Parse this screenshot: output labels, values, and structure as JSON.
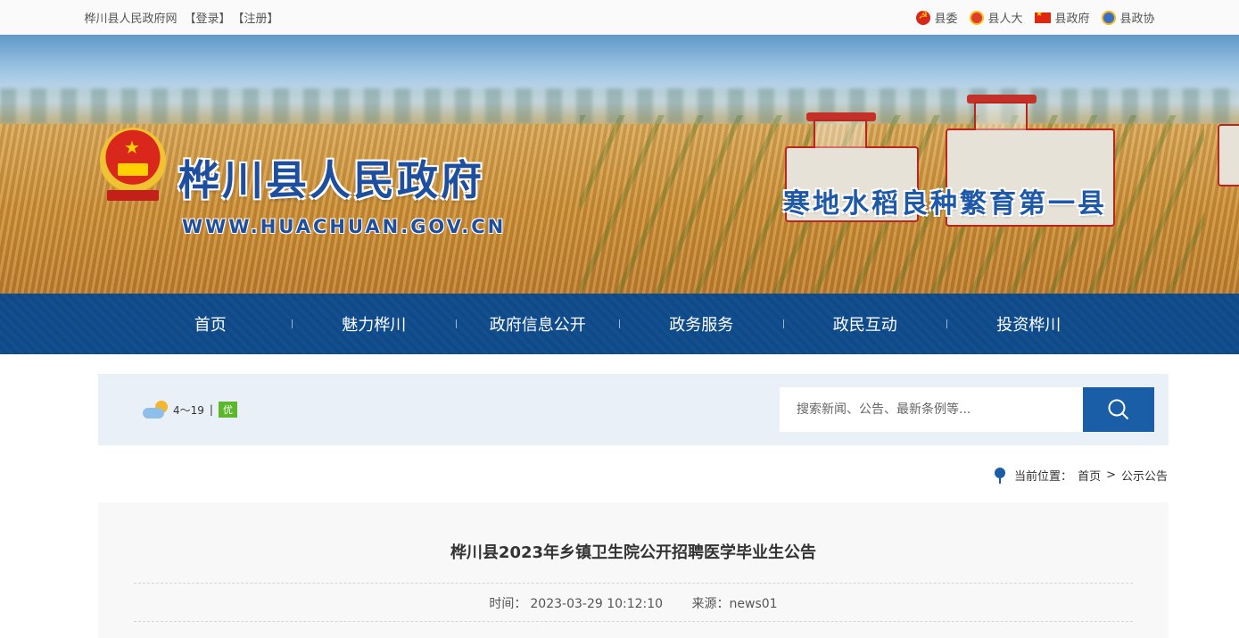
{
  "topbar": {
    "site_name": "桦川县人民政府网",
    "login": "【登录】",
    "register": "【注册】",
    "links": [
      "县委",
      "县人大",
      "县政府",
      "县政协"
    ]
  },
  "banner": {
    "title": "桦川县人民政府",
    "url": "WWW.HUACHUAN.GOV.CN",
    "slogan": "寒地水稻良种繁育第一县"
  },
  "nav": {
    "items": [
      "首页",
      "魅力桦川",
      "政府信息公开",
      "政务服务",
      "政民互动",
      "投资桦川"
    ]
  },
  "weather": {
    "temp": "4～19",
    "sep": "|",
    "aqi": "优",
    "icon": "partly-cloudy-icon"
  },
  "search": {
    "placeholder": "搜索新闻、公告、最新条例等..."
  },
  "breadcrumb": {
    "label": "当前位置：",
    "home": "首页",
    "arrow": ">",
    "current": "公示公告"
  },
  "article": {
    "title": "桦川县2023年乡镇卫生院公开招聘医学毕业生公告",
    "time_label": "时间：",
    "time": "2023-03-29 10:12:10",
    "source_label": "来源：",
    "source": "news01"
  },
  "colors": {
    "nav_bg": "#0e4a8a",
    "accent": "#1b5ea8",
    "aqi_good": "#5cb82a"
  }
}
